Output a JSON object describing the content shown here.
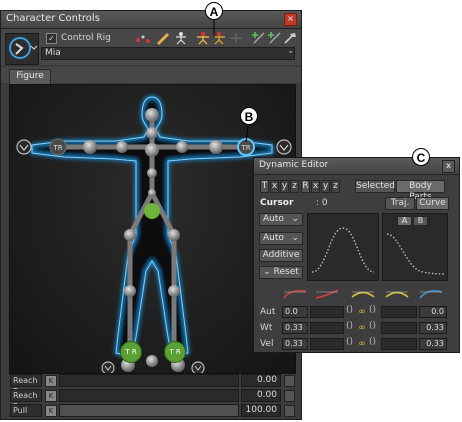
{
  "window": {
    "title": "Character Controls",
    "close": "×"
  },
  "toolbar": {
    "control_rig_checked": "✓",
    "control_rig_label": "Control Rig",
    "character_name": "Mia"
  },
  "tabs": [
    {
      "label": "Figure"
    }
  ],
  "callouts": {
    "a": "A",
    "b": "B",
    "c": "C"
  },
  "figure": {
    "reach_labels": {
      "left_leg": "T R",
      "right_leg": "T R"
    },
    "colors": {
      "glow": "#1e9be8",
      "joint": "#9a9a9a",
      "hip": "#6fb43a",
      "reach": "#5aa032"
    }
  },
  "sliders": [
    {
      "name": "Reach T",
      "value": "0.00",
      "fraction": 0
    },
    {
      "name": "Reach R",
      "value": "0.00",
      "fraction": 0
    },
    {
      "name": "Pull",
      "value": "100.00",
      "fraction": 1
    }
  ],
  "dynamic_editor": {
    "title": "Dynamic Editor",
    "close": "x",
    "axis_t": "T",
    "axis_t_xyz": [
      "x",
      "y",
      "z"
    ],
    "axis_r": "R",
    "axis_r_xyz": [
      "x",
      "y",
      "z"
    ],
    "selected_label": "Selected",
    "body_parts_label": "Body Parts",
    "cursor_label": "Cursor",
    "cursor_value": ": 0",
    "traj_label": "Traj.",
    "curve_label": "Curve",
    "auto1": "Auto",
    "auto2": "Auto",
    "additive": "Additive",
    "reset": "Reset",
    "ab": [
      "A",
      "B"
    ],
    "rows": [
      {
        "label": "Aut",
        "left": "0.0",
        "right": "0.0"
      },
      {
        "label": "Wt",
        "left": "0.33",
        "right": "0.33"
      },
      {
        "label": "Vel",
        "left": "0.33",
        "right": "0.33"
      }
    ]
  }
}
